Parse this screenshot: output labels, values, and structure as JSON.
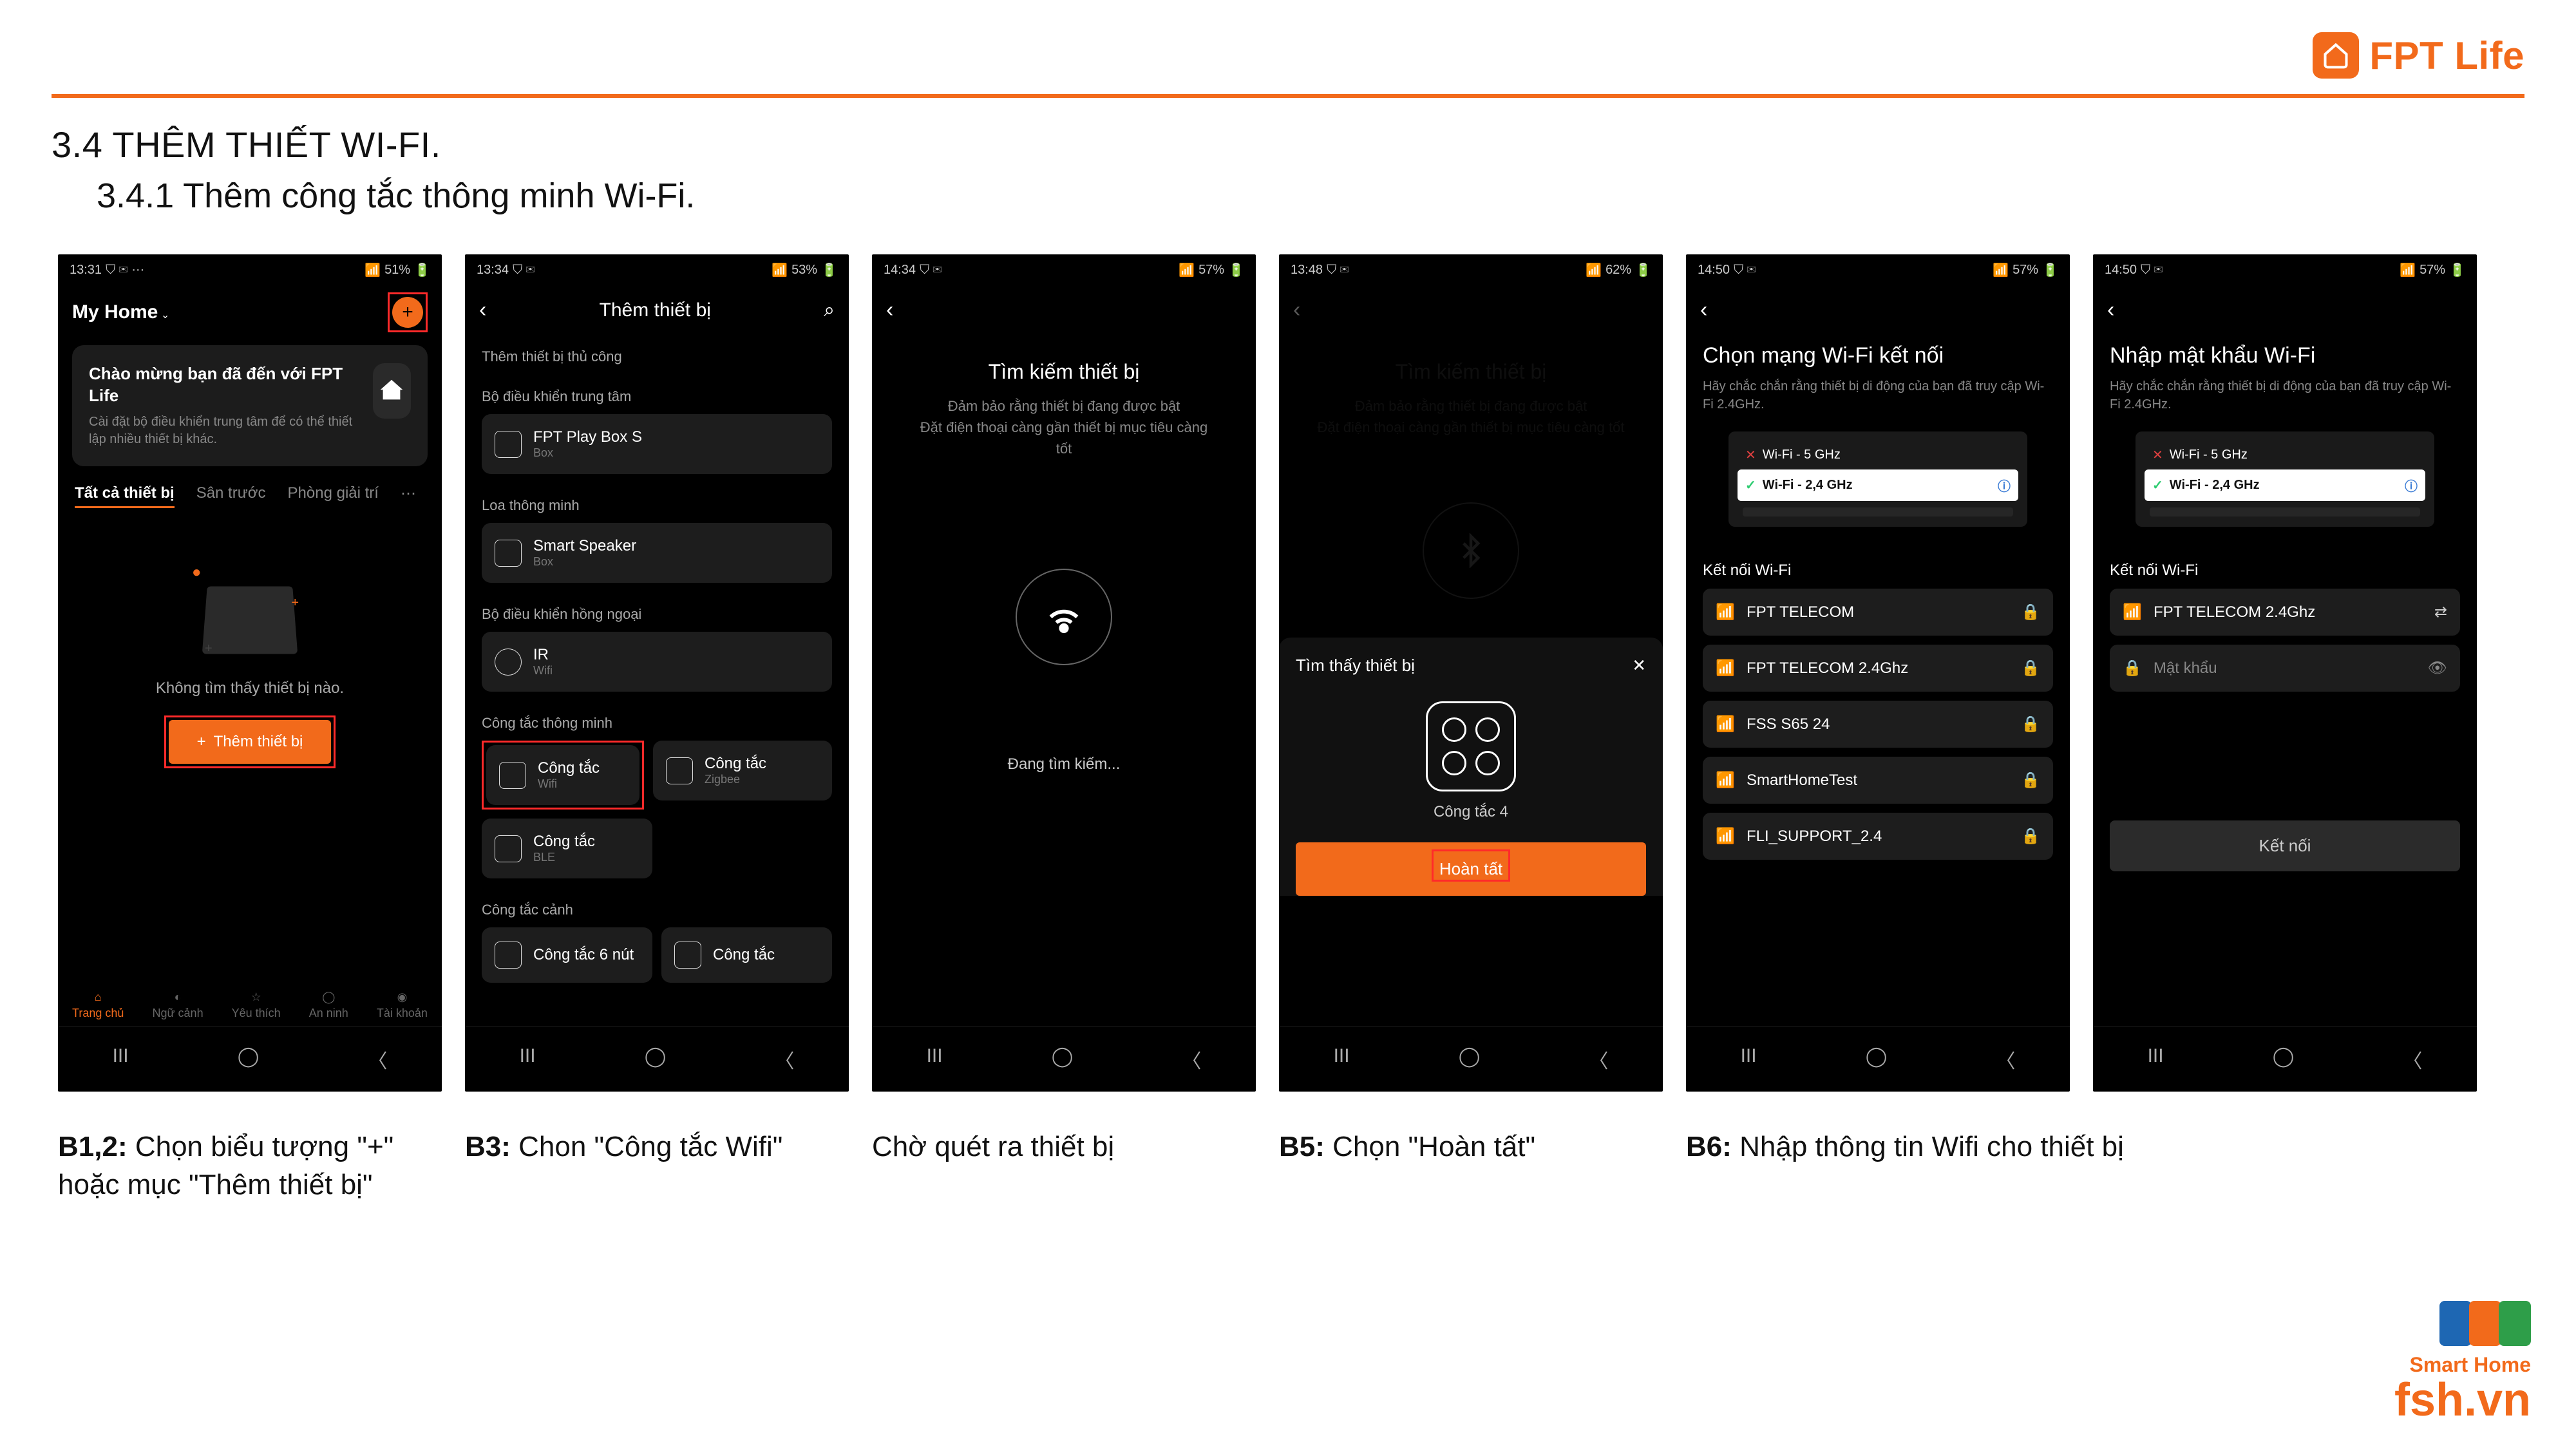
{
  "brand": {
    "name": "FPT Life"
  },
  "heading": "3.4 THÊM THIẾT WI-FI.",
  "subheading": "3.4.1 Thêm công tắc thông minh Wi-Fi.",
  "captions": {
    "b12_label": "B1,2:",
    "b12_text": " Chọn biểu tượng \"+\" hoặc mục \"Thêm thiết bị\"",
    "b3_label": "B3:",
    "b3_text": " Chon \"Công tắc Wifi\"",
    "b4_text": "Chờ quét ra thiết bị",
    "b5_label": "B5:",
    "b5_text": " Chọn \"Hoàn tất\"",
    "b6_label": "B6:",
    "b6_text": " Nhập thông tin Wifi cho thiết bị"
  },
  "s1": {
    "time": "13:31",
    "battery": "51%",
    "home": "My Home",
    "welcome_title": "Chào mừng bạn đã đến với FPT Life",
    "welcome_sub": "Cài đặt bộ điều khiển trung tâm để có thể thiết lập nhiều thiết bị khác.",
    "tabs": {
      "all": "Tất cả thiết bị",
      "t2": "Sân trước",
      "t3": "Phòng giải trí"
    },
    "empty": "Không tìm thấy thiết bị nào.",
    "add": "Thêm thiết bị",
    "nav": {
      "home": "Trang chủ",
      "scene": "Ngữ cảnh",
      "fav": "Yêu thích",
      "sec": "An ninh",
      "acc": "Tài khoản"
    }
  },
  "s2": {
    "time": "13:34",
    "battery": "53%",
    "title": "Thêm thiết bị",
    "manual": "Thêm thiết bị thủ công",
    "cat_hub": "Bộ điều khiển trung tâm",
    "hub_name": "FPT Play Box S",
    "hub_sub": "Box",
    "cat_speaker": "Loa thông minh",
    "speaker_name": "Smart Speaker",
    "speaker_sub": "Box",
    "cat_ir": "Bộ điều khiển hồng ngoại",
    "ir_name": "IR",
    "ir_sub": "Wifi",
    "cat_switch": "Công tắc thông minh",
    "sw_wifi": "Công tắc",
    "sw_wifi_sub": "Wifi",
    "sw_zig": "Công tắc",
    "sw_zig_sub": "Zigbee",
    "sw_ble": "Công tắc",
    "sw_ble_sub": "BLE",
    "cat_scene": "Công tắc cảnh",
    "scene6": "Công tắc 6 nút",
    "scene1": "Công tắc"
  },
  "s3": {
    "time": "14:34",
    "battery": "57%",
    "title": "Tìm kiếm thiết bị",
    "sub1": "Đảm bảo rằng thiết bị đang được bật",
    "sub2": "Đặt điện thoại càng gần thiết bị mục tiêu càng tốt",
    "searching": "Đang tìm kiếm..."
  },
  "s4": {
    "time": "13:48",
    "battery": "62%",
    "title_ghost": "Tìm kiếm thiết bị",
    "found": "Tìm thấy thiết bị",
    "device": "Công tắc 4",
    "done": "Hoàn tất"
  },
  "s5": {
    "time": "14:50",
    "battery": "57%",
    "title": "Chọn mạng Wi-Fi kết nối",
    "sub": "Hãy chắc chắn rằng thiết bị di động của bạn đã truy cập Wi-Fi 2.4GHz.",
    "b5": "Wi-Fi - 5 GHz",
    "b24": "Wi-Fi - 2,4 GHz",
    "connect": "Kết nối Wi-Fi",
    "nets": [
      "FPT TELECOM",
      "FPT TELECOM 2.4Ghz",
      "FSS S65 24",
      "SmartHomeTest",
      "FLI_SUPPORT_2.4"
    ]
  },
  "s6": {
    "time": "14:50",
    "battery": "57%",
    "title": "Nhập mật khẩu Wi-Fi",
    "sub": "Hãy chắc chắn rằng thiết bị di động của bạn đã truy cập Wi-Fi 2.4GHz.",
    "b5": "Wi-Fi - 5 GHz",
    "b24": "Wi-Fi - 2,4 GHz",
    "connect": "Kết nối Wi-Fi",
    "net": "FPT TELECOM 2.4Ghz",
    "pw_ph": "Mật khẩu",
    "btn": "Kết nối"
  },
  "footer": {
    "brand": "Smart Home",
    "url": "fsh.vn"
  }
}
